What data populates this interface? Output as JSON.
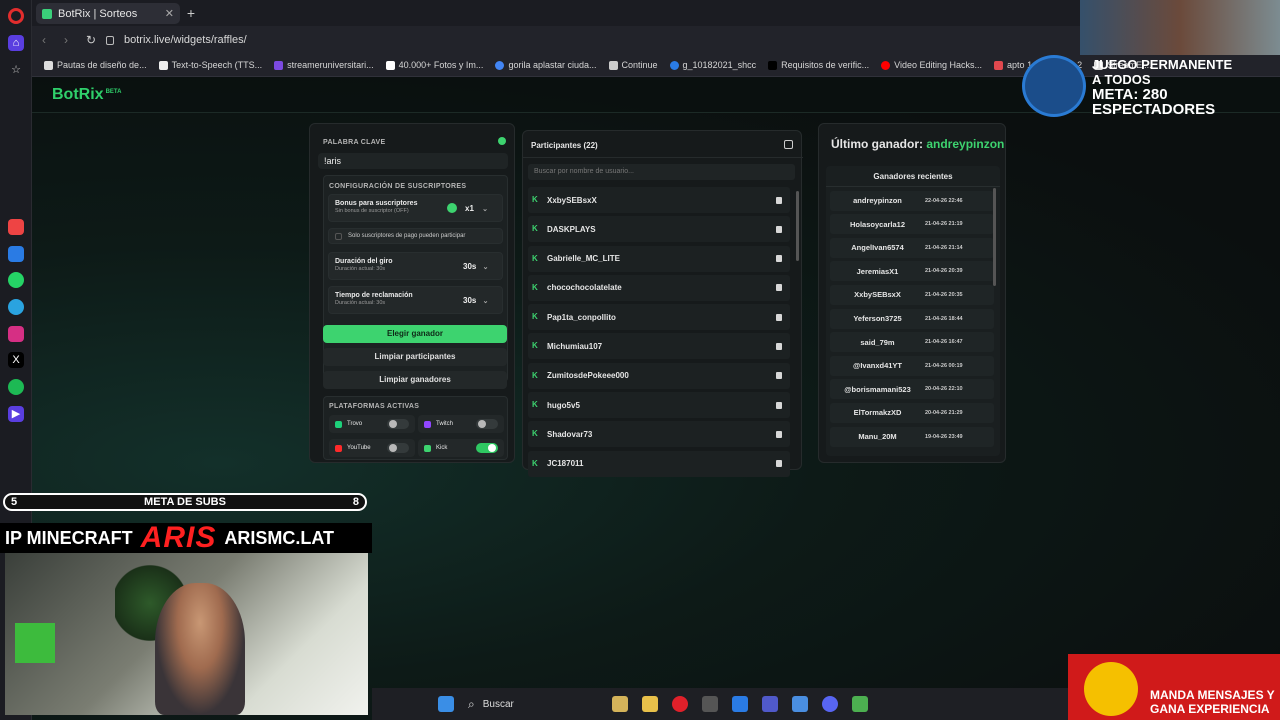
{
  "browser": {
    "tab_title": "BotRix | Sorteos",
    "url": "botrix.live/widgets/raffles/",
    "bookmarks": [
      "Pautas de diseño de...",
      "Text-to-Speech (TTS...",
      "streameruniversitari...",
      "40.000+ Fotos y Im...",
      "gorila aplastar ciuda...",
      "Continue",
      "g_10182021_shcc",
      "Requisitos de verific...",
      "Video Editing Hacks...",
      "apto 1",
      "apto 2",
      "StreamEl..."
    ]
  },
  "app": {
    "logo": "BotRix",
    "logo_badge": "BETA"
  },
  "config": {
    "keyword_label": "PALABRA CLAVE",
    "keyword_value": "!aris",
    "subs_label": "CONFIGURACIÓN DE SUSCRIPTORES",
    "bonus_title": "Bonus para suscriptores",
    "bonus_sub": "Sin bonus de suscriptor (OFF)",
    "bonus_value": "x1",
    "only_paid": "Solo suscriptores de pago pueden participar",
    "spin_title": "Duración del giro",
    "spin_sub": "Duración actual: 30s",
    "spin_value": "30s",
    "claim_title": "Tiempo de reclamación",
    "claim_sub": "Duración actual: 30s",
    "claim_value": "30s",
    "btn_choose": "Elegir ganador",
    "btn_clear_participants": "Limpiar participantes",
    "btn_clear_winners": "Limpiar ganadores",
    "platforms_label": "PLATAFORMAS ACTIVAS",
    "platforms": [
      {
        "name": "Trovo",
        "on": false,
        "color": "#1dd07a"
      },
      {
        "name": "Twitch",
        "on": false,
        "color": "#9146ff"
      },
      {
        "name": "YouTube",
        "on": false,
        "color": "#ff2a2a"
      },
      {
        "name": "Kick",
        "on": true,
        "color": "#3dd36f"
      }
    ]
  },
  "participants": {
    "title": "Participantes (22)",
    "search_placeholder": "Buscar por nombre de usuario...",
    "list": [
      "XxbySEBsxX",
      "DASKPLAYS",
      "Gabrielle_MC_LITE",
      "chocochocolatelate",
      "Pap1ta_conpollito",
      "Michumiau107",
      "ZumitosdePokeee000",
      "hugo5v5",
      "Shadovar73",
      "JC187011"
    ]
  },
  "winners": {
    "title_prefix": "Último ganador:",
    "title_name": "andreypinzon",
    "recent_label": "Ganadores recientes",
    "list": [
      {
        "name": "andreypinzon",
        "date": "22-04-26 22:46"
      },
      {
        "name": "Holasoycarla12",
        "date": "21-04-26 21:19"
      },
      {
        "name": "AngelIvan6574",
        "date": "21-04-26 21:14"
      },
      {
        "name": "JeremiasX1",
        "date": "21-04-26 20:39"
      },
      {
        "name": "XxbySEBsxX",
        "date": "21-04-26 20:35"
      },
      {
        "name": "Yeferson3725",
        "date": "21-04-26 18:44"
      },
      {
        "name": "said_79m",
        "date": "21-04-26 16:47"
      },
      {
        "name": "@Ivanxd41YT",
        "date": "21-04-26 00:19"
      },
      {
        "name": "@borismamani523",
        "date": "20-04-26 22:10"
      },
      {
        "name": "ElTormakzXD",
        "date": "20-04-26 21:29"
      },
      {
        "name": "Manu_20M",
        "date": "19-04-26 23:49"
      }
    ]
  },
  "overlay": {
    "subs_left": "5",
    "subs_label": "META DE SUBS",
    "subs_right": "8",
    "ip_label": "IP MINECRAFT",
    "aris": "ARIS",
    "ip_value": "ARISMC.LAT",
    "steam_line1": "JUEGO PERMANENTE",
    "steam_line2": "A TODOS",
    "steam_meta": "META: 280 ESPECTADORES",
    "mensajes_line1": "MANDA MENSAJES Y",
    "mensajes_line2": "GANA EXPERIENCIA"
  },
  "taskbar": {
    "search": "Buscar"
  }
}
